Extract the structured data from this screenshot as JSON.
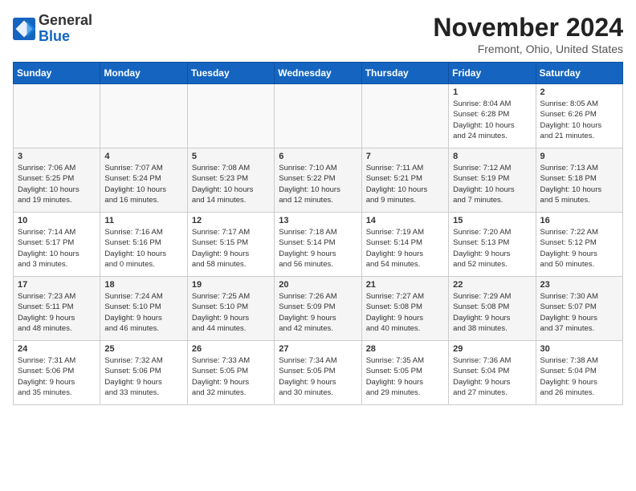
{
  "header": {
    "logo_general": "General",
    "logo_blue": "Blue",
    "month_title": "November 2024",
    "location": "Fremont, Ohio, United States"
  },
  "weekdays": [
    "Sunday",
    "Monday",
    "Tuesday",
    "Wednesday",
    "Thursday",
    "Friday",
    "Saturday"
  ],
  "weeks": [
    [
      {
        "day": "",
        "detail": ""
      },
      {
        "day": "",
        "detail": ""
      },
      {
        "day": "",
        "detail": ""
      },
      {
        "day": "",
        "detail": ""
      },
      {
        "day": "",
        "detail": ""
      },
      {
        "day": "1",
        "detail": "Sunrise: 8:04 AM\nSunset: 6:28 PM\nDaylight: 10 hours\nand 24 minutes."
      },
      {
        "day": "2",
        "detail": "Sunrise: 8:05 AM\nSunset: 6:26 PM\nDaylight: 10 hours\nand 21 minutes."
      }
    ],
    [
      {
        "day": "3",
        "detail": "Sunrise: 7:06 AM\nSunset: 5:25 PM\nDaylight: 10 hours\nand 19 minutes."
      },
      {
        "day": "4",
        "detail": "Sunrise: 7:07 AM\nSunset: 5:24 PM\nDaylight: 10 hours\nand 16 minutes."
      },
      {
        "day": "5",
        "detail": "Sunrise: 7:08 AM\nSunset: 5:23 PM\nDaylight: 10 hours\nand 14 minutes."
      },
      {
        "day": "6",
        "detail": "Sunrise: 7:10 AM\nSunset: 5:22 PM\nDaylight: 10 hours\nand 12 minutes."
      },
      {
        "day": "7",
        "detail": "Sunrise: 7:11 AM\nSunset: 5:21 PM\nDaylight: 10 hours\nand 9 minutes."
      },
      {
        "day": "8",
        "detail": "Sunrise: 7:12 AM\nSunset: 5:19 PM\nDaylight: 10 hours\nand 7 minutes."
      },
      {
        "day": "9",
        "detail": "Sunrise: 7:13 AM\nSunset: 5:18 PM\nDaylight: 10 hours\nand 5 minutes."
      }
    ],
    [
      {
        "day": "10",
        "detail": "Sunrise: 7:14 AM\nSunset: 5:17 PM\nDaylight: 10 hours\nand 3 minutes."
      },
      {
        "day": "11",
        "detail": "Sunrise: 7:16 AM\nSunset: 5:16 PM\nDaylight: 10 hours\nand 0 minutes."
      },
      {
        "day": "12",
        "detail": "Sunrise: 7:17 AM\nSunset: 5:15 PM\nDaylight: 9 hours\nand 58 minutes."
      },
      {
        "day": "13",
        "detail": "Sunrise: 7:18 AM\nSunset: 5:14 PM\nDaylight: 9 hours\nand 56 minutes."
      },
      {
        "day": "14",
        "detail": "Sunrise: 7:19 AM\nSunset: 5:14 PM\nDaylight: 9 hours\nand 54 minutes."
      },
      {
        "day": "15",
        "detail": "Sunrise: 7:20 AM\nSunset: 5:13 PM\nDaylight: 9 hours\nand 52 minutes."
      },
      {
        "day": "16",
        "detail": "Sunrise: 7:22 AM\nSunset: 5:12 PM\nDaylight: 9 hours\nand 50 minutes."
      }
    ],
    [
      {
        "day": "17",
        "detail": "Sunrise: 7:23 AM\nSunset: 5:11 PM\nDaylight: 9 hours\nand 48 minutes."
      },
      {
        "day": "18",
        "detail": "Sunrise: 7:24 AM\nSunset: 5:10 PM\nDaylight: 9 hours\nand 46 minutes."
      },
      {
        "day": "19",
        "detail": "Sunrise: 7:25 AM\nSunset: 5:10 PM\nDaylight: 9 hours\nand 44 minutes."
      },
      {
        "day": "20",
        "detail": "Sunrise: 7:26 AM\nSunset: 5:09 PM\nDaylight: 9 hours\nand 42 minutes."
      },
      {
        "day": "21",
        "detail": "Sunrise: 7:27 AM\nSunset: 5:08 PM\nDaylight: 9 hours\nand 40 minutes."
      },
      {
        "day": "22",
        "detail": "Sunrise: 7:29 AM\nSunset: 5:08 PM\nDaylight: 9 hours\nand 38 minutes."
      },
      {
        "day": "23",
        "detail": "Sunrise: 7:30 AM\nSunset: 5:07 PM\nDaylight: 9 hours\nand 37 minutes."
      }
    ],
    [
      {
        "day": "24",
        "detail": "Sunrise: 7:31 AM\nSunset: 5:06 PM\nDaylight: 9 hours\nand 35 minutes."
      },
      {
        "day": "25",
        "detail": "Sunrise: 7:32 AM\nSunset: 5:06 PM\nDaylight: 9 hours\nand 33 minutes."
      },
      {
        "day": "26",
        "detail": "Sunrise: 7:33 AM\nSunset: 5:05 PM\nDaylight: 9 hours\nand 32 minutes."
      },
      {
        "day": "27",
        "detail": "Sunrise: 7:34 AM\nSunset: 5:05 PM\nDaylight: 9 hours\nand 30 minutes."
      },
      {
        "day": "28",
        "detail": "Sunrise: 7:35 AM\nSunset: 5:05 PM\nDaylight: 9 hours\nand 29 minutes."
      },
      {
        "day": "29",
        "detail": "Sunrise: 7:36 AM\nSunset: 5:04 PM\nDaylight: 9 hours\nand 27 minutes."
      },
      {
        "day": "30",
        "detail": "Sunrise: 7:38 AM\nSunset: 5:04 PM\nDaylight: 9 hours\nand 26 minutes."
      }
    ]
  ]
}
